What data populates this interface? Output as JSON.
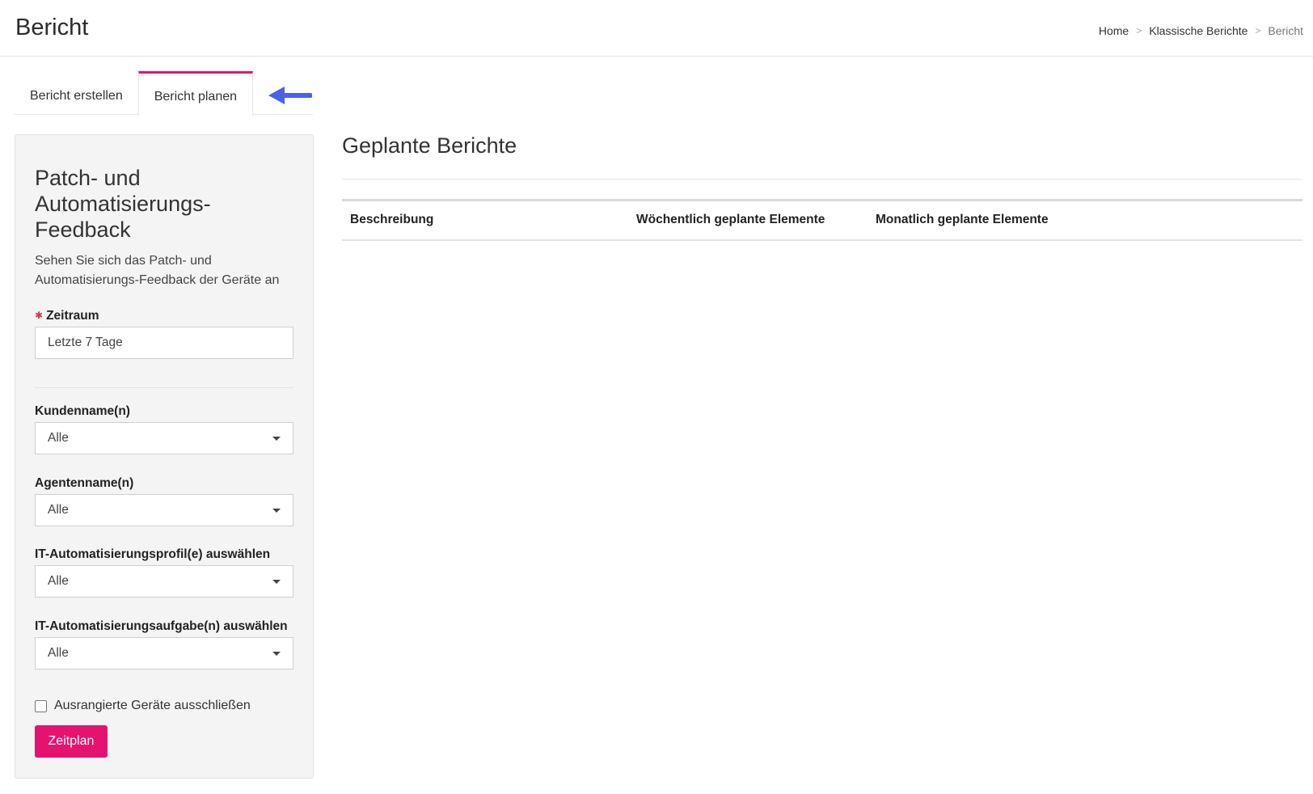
{
  "header": {
    "title": "Bericht",
    "breadcrumb": [
      {
        "label": "Home"
      },
      {
        "label": "Klassische Berichte"
      },
      {
        "label": "Bericht"
      }
    ],
    "separator": ">"
  },
  "tabs": [
    {
      "label": "Bericht erstellen",
      "active": false
    },
    {
      "label": "Bericht planen",
      "active": true
    }
  ],
  "annotation": {
    "arrow_color": "#4a62e8",
    "points_to": "Bericht planen"
  },
  "form": {
    "title": "Patch- und Automatisierungs-Feedback",
    "description": "Sehen Sie sich das Patch- und Automatisierungs-Feedback der Geräte an",
    "timerange": {
      "label": "Zeitraum",
      "required": true,
      "value": "Letzte 7 Tage"
    },
    "customers": {
      "label": "Kundenname(n)",
      "value": "Alle"
    },
    "agents": {
      "label": "Agentenname(n)",
      "value": "Alle"
    },
    "profiles": {
      "label": "IT-Automatisierungsprofil(e) auswählen",
      "value": "Alle"
    },
    "tasks": {
      "label": "IT-Automatisierungsaufgabe(n) auswählen",
      "value": "Alle"
    },
    "exclude_retired": {
      "label": "Ausrangierte Geräte ausschließen",
      "checked": false
    },
    "submit_label": "Zeitplan"
  },
  "scheduled": {
    "title": "Geplante Berichte",
    "columns": [
      "Beschreibung",
      "Wöchentlich geplante Elemente",
      "Monatlich geplante Elemente"
    ],
    "rows": []
  },
  "colors": {
    "accent": "#e5136f",
    "required_star": "#d9314a",
    "panel_bg": "#f4f4f4"
  }
}
